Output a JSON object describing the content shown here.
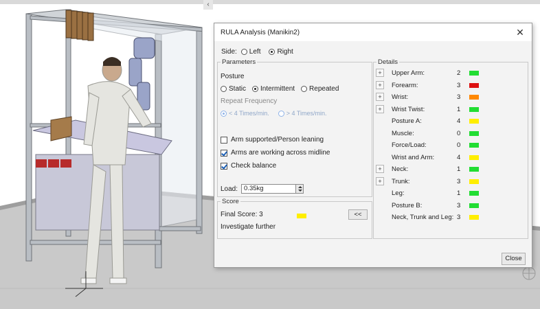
{
  "dialog": {
    "title": "RULA Analysis (Manikin2)",
    "close_glyph": "✕"
  },
  "collapse_glyph": "‹",
  "side": {
    "label": "Side:",
    "options": [
      "Left",
      "Right"
    ],
    "selected": "Right"
  },
  "parameters": {
    "legend": "Parameters",
    "posture_label": "Posture",
    "posture_options": [
      "Static",
      "Intermittent",
      "Repeated"
    ],
    "posture_selected": "Intermittent",
    "repeat_label": "Repeat Frequency",
    "repeat_options": [
      "< 4 Times/min.",
      "> 4 Times/min."
    ],
    "checkboxes": [
      {
        "label": "Arm supported/Person leaning",
        "checked": false
      },
      {
        "label": "Arms are working across midline",
        "checked": true
      },
      {
        "label": "Check balance",
        "checked": true
      }
    ],
    "load_label": "Load:",
    "load_value": "0.35kg"
  },
  "score": {
    "legend": "Score",
    "final_label": "Final Score: 3",
    "final_color": "#ffee00",
    "advice": "Investigate further",
    "collapse_button": "<<"
  },
  "details": {
    "legend": "Details",
    "rows": [
      {
        "label": "Upper Arm:",
        "value": "2",
        "color": "#22dd33",
        "expandable": true
      },
      {
        "label": "Forearm:",
        "value": "3",
        "color": "#dd1111",
        "expandable": true
      },
      {
        "label": "Wrist:",
        "value": "3",
        "color": "#ff8800",
        "expandable": true
      },
      {
        "label": "Wrist Twist:",
        "value": "1",
        "color": "#22dd33",
        "expandable": true
      },
      {
        "label": "Posture A:",
        "value": "4",
        "color": "#ffee00",
        "expandable": false
      },
      {
        "label": "Muscle:",
        "value": "0",
        "color": "#22dd33",
        "expandable": false
      },
      {
        "label": "Force/Load:",
        "value": "0",
        "color": "#22dd33",
        "expandable": false
      },
      {
        "label": "Wrist and Arm:",
        "value": "4",
        "color": "#ffee00",
        "expandable": false
      },
      {
        "label": "Neck:",
        "value": "1",
        "color": "#22dd33",
        "expandable": true
      },
      {
        "label": "Trunk:",
        "value": "3",
        "color": "#ffee00",
        "expandable": true
      },
      {
        "label": "Leg:",
        "value": "1",
        "color": "#22dd33",
        "expandable": false
      },
      {
        "label": "Posture B:",
        "value": "3",
        "color": "#22dd33",
        "expandable": false
      },
      {
        "label": "Neck, Trunk and Leg:",
        "value": "3",
        "color": "#ffee00",
        "expandable": false
      }
    ]
  },
  "close_button": "Close"
}
